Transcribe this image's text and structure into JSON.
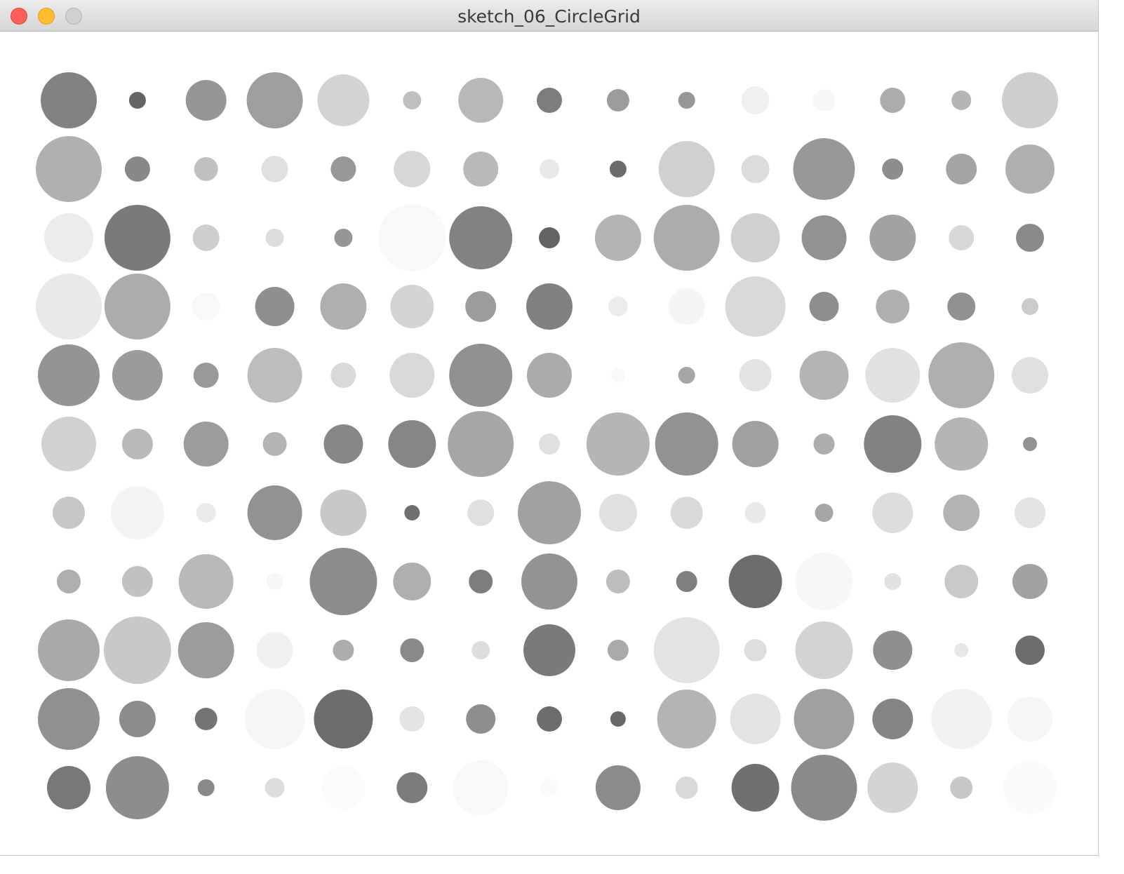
{
  "window": {
    "title": "sketch_06_CircleGrid",
    "buttons": {
      "close_color": "#fe5f57",
      "minimize_color": "#febc2e",
      "zoom_color": "#d0d0d0"
    }
  },
  "grid": {
    "cols": 15,
    "rows": 11,
    "cells": [
      [
        [
          40,
          130
        ],
        [
          12,
          100
        ],
        [
          29,
          150
        ],
        [
          40,
          158
        ],
        [
          37,
          211
        ],
        [
          13,
          192
        ],
        [
          32,
          184
        ],
        [
          18,
          125
        ],
        [
          16,
          156
        ],
        [
          12,
          151
        ],
        [
          20,
          240
        ],
        [
          16,
          247
        ],
        [
          18,
          172
        ],
        [
          14,
          181
        ],
        [
          40,
          206
        ]
      ],
      [
        [
          47,
          176
        ],
        [
          18,
          136
        ],
        [
          17,
          193
        ],
        [
          19,
          224
        ],
        [
          18,
          152
        ],
        [
          26,
          215
        ],
        [
          25,
          185
        ],
        [
          14,
          233
        ],
        [
          12,
          107
        ],
        [
          40,
          208
        ],
        [
          20,
          220
        ],
        [
          44,
          152
        ],
        [
          15,
          141
        ],
        [
          22,
          164
        ],
        [
          35,
          176
        ]
      ],
      [
        [
          35,
          236
        ],
        [
          47,
          122
        ],
        [
          19,
          206
        ],
        [
          13,
          221
        ],
        [
          13,
          150
        ],
        [
          48,
          248
        ],
        [
          45,
          130
        ],
        [
          15,
          99
        ],
        [
          33,
          180
        ],
        [
          47,
          172
        ],
        [
          35,
          208
        ],
        [
          32,
          146
        ],
        [
          33,
          162
        ],
        [
          18,
          216
        ],
        [
          20,
          138
        ]
      ],
      [
        [
          47,
          233
        ],
        [
          47,
          172
        ],
        [
          20,
          248
        ],
        [
          28,
          143
        ],
        [
          33,
          175
        ],
        [
          31,
          212
        ],
        [
          22,
          156
        ],
        [
          33,
          129
        ],
        [
          14,
          236
        ],
        [
          26,
          245
        ],
        [
          43,
          217
        ],
        [
          21,
          142
        ],
        [
          24,
          176
        ],
        [
          20,
          145
        ],
        [
          12,
          203
        ]
      ],
      [
        [
          44,
          148
        ],
        [
          36,
          155
        ],
        [
          18,
          153
        ],
        [
          39,
          189
        ],
        [
          18,
          217
        ],
        [
          32,
          217
        ],
        [
          45,
          145
        ],
        [
          32,
          171
        ],
        [
          10,
          248
        ],
        [
          12,
          166
        ],
        [
          23,
          227
        ],
        [
          35,
          180
        ],
        [
          39,
          225
        ],
        [
          47,
          175
        ],
        [
          26,
          224
        ]
      ],
      [
        [
          39,
          209
        ],
        [
          22,
          186
        ],
        [
          32,
          156
        ],
        [
          17,
          180
        ],
        [
          28,
          135
        ],
        [
          34,
          134
        ],
        [
          47,
          166
        ],
        [
          15,
          224
        ],
        [
          45,
          181
        ],
        [
          45,
          146
        ],
        [
          33,
          160
        ],
        [
          15,
          174
        ],
        [
          41,
          130
        ],
        [
          38,
          181
        ],
        [
          10,
          146
        ]
      ],
      [
        [
          23,
          199
        ],
        [
          38,
          244
        ],
        [
          14,
          234
        ],
        [
          39,
          146
        ],
        [
          33,
          200
        ],
        [
          11,
          111
        ],
        [
          19,
          224
        ],
        [
          45,
          161
        ],
        [
          27,
          224
        ],
        [
          23,
          218
        ],
        [
          15,
          233
        ],
        [
          13,
          166
        ],
        [
          29,
          221
        ],
        [
          26,
          179
        ],
        [
          22,
          227
        ]
      ],
      [
        [
          17,
          175
        ],
        [
          22,
          193
        ],
        [
          39,
          185
        ],
        [
          12,
          246
        ],
        [
          48,
          140
        ],
        [
          27,
          175
        ],
        [
          17,
          125
        ],
        [
          40,
          147
        ],
        [
          17,
          189
        ],
        [
          15,
          127
        ],
        [
          38,
          109
        ],
        [
          41,
          247
        ],
        [
          12,
          226
        ],
        [
          24,
          201
        ],
        [
          25,
          162
        ]
      ],
      [
        [
          44,
          169
        ],
        [
          48,
          200
        ],
        [
          40,
          156
        ],
        [
          26,
          240
        ],
        [
          15,
          173
        ],
        [
          17,
          137
        ],
        [
          13,
          221
        ],
        [
          37,
          122
        ],
        [
          15,
          170
        ],
        [
          47,
          227
        ],
        [
          16,
          222
        ],
        [
          41,
          211
        ],
        [
          28,
          143
        ],
        [
          10,
          231
        ],
        [
          21,
          109
        ]
      ],
      [
        [
          44,
          144
        ],
        [
          26,
          140
        ],
        [
          16,
          116
        ],
        [
          43,
          246
        ],
        [
          42,
          109
        ],
        [
          18,
          228
        ],
        [
          21,
          142
        ],
        [
          18,
          109
        ],
        [
          11,
          104
        ],
        [
          42,
          180
        ],
        [
          36,
          227
        ],
        [
          43,
          160
        ],
        [
          29,
          133
        ],
        [
          43,
          242
        ],
        [
          32,
          246
        ]
      ],
      [
        [
          31,
          120
        ],
        [
          45,
          141
        ],
        [
          12,
          137
        ],
        [
          14,
          221
        ],
        [
          31,
          251
        ],
        [
          22,
          124
        ],
        [
          39,
          248
        ],
        [
          13,
          250
        ],
        [
          32,
          139
        ],
        [
          16,
          217
        ],
        [
          34,
          112
        ],
        [
          47,
          138
        ],
        [
          36,
          212
        ],
        [
          16,
          200
        ],
        [
          38,
          250
        ]
      ]
    ]
  }
}
